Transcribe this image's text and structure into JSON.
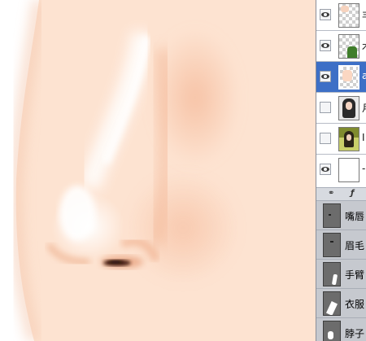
{
  "layers_panel": {
    "layers": [
      {
        "label": "丰",
        "visible": true
      },
      {
        "label": "木",
        "visible": true
      },
      {
        "label": "a",
        "visible": true,
        "selected": true
      },
      {
        "label": "月",
        "visible": false
      },
      {
        "label": "I",
        "visible": false
      },
      {
        "label": "-",
        "visible": true
      }
    ],
    "link_bar": {
      "link_icon": "chain-link-icon",
      "effects_icon": "fx-icon"
    },
    "sub_layers": [
      {
        "label": "嘴唇"
      },
      {
        "label": "眉毛"
      },
      {
        "label": "手臂"
      },
      {
        "label": "衣服"
      },
      {
        "label": "脖子"
      }
    ]
  },
  "colors": {
    "skin": "#fde3d1",
    "highlight": "#ffffff",
    "shadow": "#f3b796",
    "nostril": "#4a2418",
    "selection": "#3d6fc6"
  }
}
